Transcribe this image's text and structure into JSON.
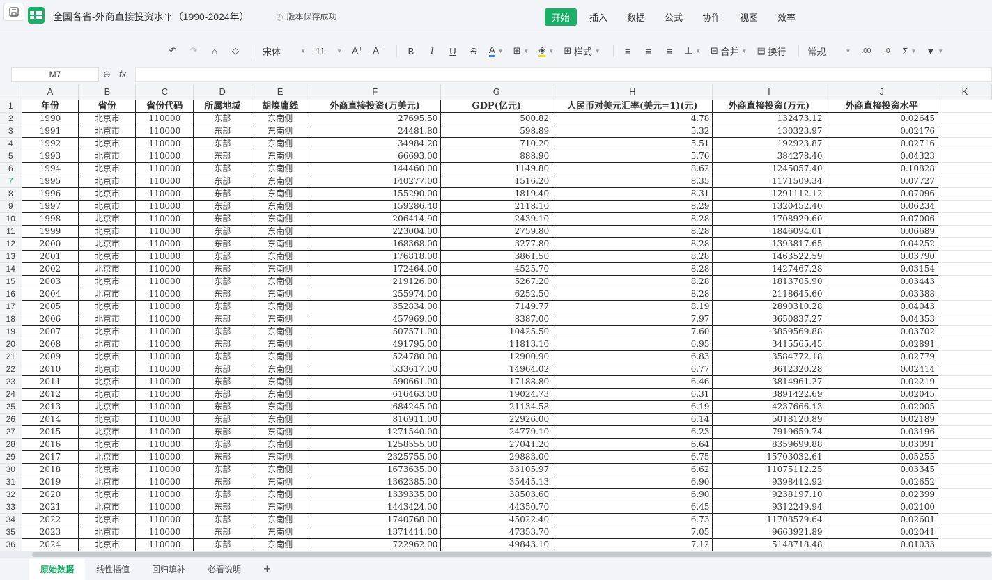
{
  "header": {
    "title": "全国各省-外商直接投资水平（1990-2024年）",
    "save_status": "版本保存成功",
    "menu": [
      "开始",
      "插入",
      "数据",
      "公式",
      "协作",
      "视图",
      "效率"
    ],
    "active_menu": "开始"
  },
  "toolbar": {
    "font": "宋体",
    "size": "11",
    "style": "样式",
    "merge": "合并",
    "wrap": "换行",
    "number_format": "常规"
  },
  "formula": {
    "cell_ref": "M7",
    "content": ""
  },
  "columns": [
    "A",
    "B",
    "C",
    "D",
    "E",
    "F",
    "G",
    "H",
    "I",
    "J",
    "K"
  ],
  "headers": [
    "年份",
    "省份",
    "省份代码",
    "所属地域",
    "胡焕庸线",
    "外商直接投资(万美元)",
    "GDP(亿元)",
    "人民币对美元汇率(美元=1)(元)",
    "外商直接投资(万元)",
    "外商直接投资水平"
  ],
  "province": "北京市",
  "code": "110000",
  "region": "东部",
  "hu_line": "东南侧",
  "rows": [
    [
      "1990",
      "27695.50",
      "500.82",
      "4.78",
      "132473.12",
      "0.02645"
    ],
    [
      "1991",
      "24481.80",
      "598.89",
      "5.32",
      "130323.97",
      "0.02176"
    ],
    [
      "1992",
      "34984.20",
      "710.20",
      "5.51",
      "192923.87",
      "0.02716"
    ],
    [
      "1993",
      "66693.00",
      "888.90",
      "5.76",
      "384278.40",
      "0.04323"
    ],
    [
      "1994",
      "144460.00",
      "1149.80",
      "8.62",
      "1245057.40",
      "0.10828"
    ],
    [
      "1995",
      "140277.00",
      "1516.20",
      "8.35",
      "1171509.34",
      "0.07727"
    ],
    [
      "1996",
      "155290.00",
      "1819.40",
      "8.31",
      "1291112.12",
      "0.07096"
    ],
    [
      "1997",
      "159286.40",
      "2118.10",
      "8.29",
      "1320452.40",
      "0.06234"
    ],
    [
      "1998",
      "206414.90",
      "2439.10",
      "8.28",
      "1708929.60",
      "0.07006"
    ],
    [
      "1999",
      "223004.00",
      "2759.80",
      "8.28",
      "1846094.01",
      "0.06689"
    ],
    [
      "2000",
      "168368.00",
      "3277.80",
      "8.28",
      "1393817.65",
      "0.04252"
    ],
    [
      "2001",
      "176818.00",
      "3861.50",
      "8.28",
      "1463522.59",
      "0.03790"
    ],
    [
      "2002",
      "172464.00",
      "4525.70",
      "8.28",
      "1427467.28",
      "0.03154"
    ],
    [
      "2003",
      "219126.00",
      "5267.20",
      "8.28",
      "1813705.90",
      "0.03443"
    ],
    [
      "2004",
      "255974.00",
      "6252.50",
      "8.28",
      "2118645.60",
      "0.03388"
    ],
    [
      "2005",
      "352834.00",
      "7149.77",
      "8.19",
      "2890310.28",
      "0.04043"
    ],
    [
      "2006",
      "457969.00",
      "8387.00",
      "7.97",
      "3650837.27",
      "0.04353"
    ],
    [
      "2007",
      "507571.00",
      "10425.50",
      "7.60",
      "3859569.88",
      "0.03702"
    ],
    [
      "2008",
      "491795.00",
      "11813.10",
      "6.95",
      "3415565.45",
      "0.02891"
    ],
    [
      "2009",
      "524780.00",
      "12900.90",
      "6.83",
      "3584772.18",
      "0.02779"
    ],
    [
      "2010",
      "533617.00",
      "14964.02",
      "6.77",
      "3612320.28",
      "0.02414"
    ],
    [
      "2011",
      "590661.00",
      "17188.80",
      "6.46",
      "3814961.27",
      "0.02219"
    ],
    [
      "2012",
      "616463.00",
      "19024.73",
      "6.31",
      "3891422.69",
      "0.02045"
    ],
    [
      "2013",
      "684245.00",
      "21134.58",
      "6.19",
      "4237666.13",
      "0.02005"
    ],
    [
      "2014",
      "816911.00",
      "22926.00",
      "6.14",
      "5018120.89",
      "0.02189"
    ],
    [
      "2015",
      "1271540.00",
      "24779.10",
      "6.23",
      "7919659.74",
      "0.03196"
    ],
    [
      "2016",
      "1258555.00",
      "27041.20",
      "6.64",
      "8359699.88",
      "0.03091"
    ],
    [
      "2017",
      "2325755.00",
      "29883.00",
      "6.75",
      "15703032.61",
      "0.05255"
    ],
    [
      "2018",
      "1673635.00",
      "33105.97",
      "6.62",
      "11075112.25",
      "0.03345"
    ],
    [
      "2019",
      "1362385.00",
      "35445.13",
      "6.90",
      "9398412.92",
      "0.02652"
    ],
    [
      "2020",
      "1339335.00",
      "38503.60",
      "6.90",
      "9238197.10",
      "0.02399"
    ],
    [
      "2021",
      "1443424.00",
      "44350.70",
      "6.45",
      "9312249.94",
      "0.02100"
    ],
    [
      "2022",
      "1740768.00",
      "45022.40",
      "6.73",
      "11708579.64",
      "0.02601"
    ],
    [
      "2023",
      "1371411.00",
      "47353.70",
      "7.05",
      "9663921.89",
      "0.02041"
    ],
    [
      "2024",
      "722962.00",
      "49843.10",
      "7.12",
      "5148718.48",
      "0.01033"
    ]
  ],
  "sheets": [
    "原始数据",
    "线性插值",
    "回归填补",
    "必看说明"
  ],
  "active_sheet": "原始数据",
  "accent": "#1aae66"
}
